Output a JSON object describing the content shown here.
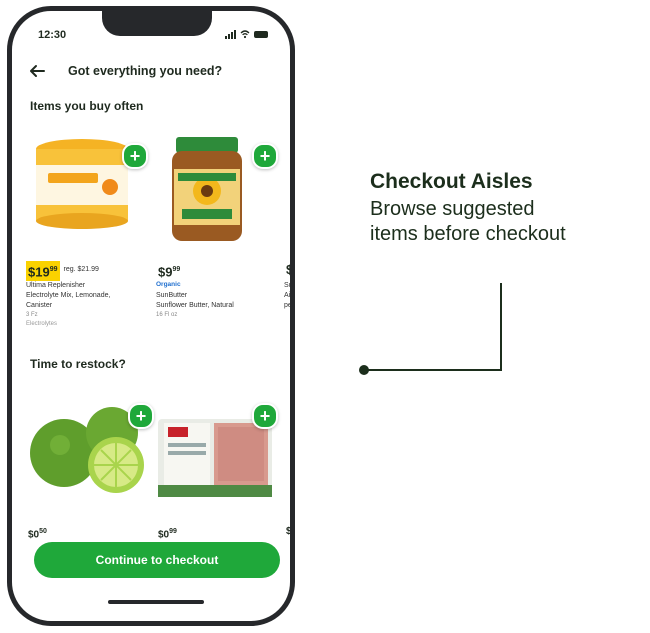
{
  "status": {
    "time": "12:30"
  },
  "nav": {
    "title": "Got everything you need?"
  },
  "sections": {
    "often": "Items you buy often",
    "restock": "Time to restock?"
  },
  "often_items": [
    {
      "price_main": "$19",
      "price_cents": "99",
      "reg_price": "reg. $21.99",
      "name_1": "Ultima Replenisher",
      "name_2": "Electrolyte Mix, Lemonade,",
      "name_3": "Canister",
      "size": "3 Fz",
      "sub": "Electrolytes"
    },
    {
      "price_main": "$9",
      "price_cents": "99",
      "tag": "Organic",
      "name_1": "SunButter",
      "name_2": "Sunflower Butter, Natural",
      "size": "16 Fl oz"
    },
    {
      "price_main": "$",
      "name_1": "Su",
      "name_2": "Ai",
      "name_3": "pe"
    }
  ],
  "restock_items": [
    {
      "price_main": "$0",
      "price_cents": "50"
    },
    {
      "price_main": "$0",
      "price_cents": "99"
    },
    {
      "price_main": "$"
    }
  ],
  "cta": {
    "label": "Continue to checkout"
  },
  "annotation": {
    "title": "Checkout Aisles",
    "line_1": "Browse suggested",
    "line_2": "items before checkout"
  },
  "colors": {
    "brand_green": "#1fa83a",
    "sale_yellow": "#fad200",
    "frame": "#26282b"
  },
  "icons": [
    "back-arrow-icon",
    "plus-icon",
    "signal-icon",
    "wifi-icon",
    "battery-icon"
  ]
}
